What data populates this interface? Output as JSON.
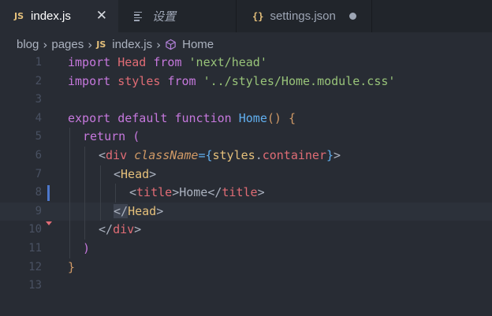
{
  "tabs": [
    {
      "icon": "JS",
      "label": "index.js",
      "close": "✕"
    },
    {
      "label": "设置"
    },
    {
      "icon": "{}",
      "label": "settings.json"
    }
  ],
  "breadcrumb": {
    "items": [
      "blog",
      "pages",
      "index.js",
      "Home"
    ],
    "file_icon": "JS"
  },
  "editor": {
    "line_numbers": [
      "1",
      "2",
      "3",
      "4",
      "5",
      "6",
      "7",
      "8",
      "9",
      "10",
      "11",
      "12",
      "13"
    ],
    "current_line": 9,
    "lines": [
      {
        "t1": "import",
        "t2": " Head ",
        "t3": "from",
        "t4": " 'next/head'"
      },
      {
        "t1": "import",
        "t2": " styles ",
        "t3": "from",
        "t4": " '../styles/Home.module.css'"
      },
      {},
      {
        "t1": "export default function",
        "t2": " Home",
        "t3": "()",
        "t4": " {"
      },
      {
        "t1": "return",
        "t2": " ("
      },
      {
        "t1": "<",
        "t2": "div",
        "t3": "className",
        "t4": "={",
        "t5": "styles",
        "t6": ".",
        "t7": "container",
        "t8": "}",
        "t9": ">"
      },
      {
        "t1": "<",
        "t2": "Head",
        "t3": ">"
      },
      {
        "t1": "<",
        "t2": "title",
        "t3": ">",
        "t4": "Home",
        "t5": "</",
        "t6": "title",
        "t7": ">"
      },
      {
        "t1": "</",
        "t2": "Head",
        "t3": ">"
      },
      {
        "t1": "</",
        "t2": "div",
        "t3": ">"
      },
      {
        "t1": ")"
      },
      {
        "t1": "}"
      },
      {}
    ]
  }
}
